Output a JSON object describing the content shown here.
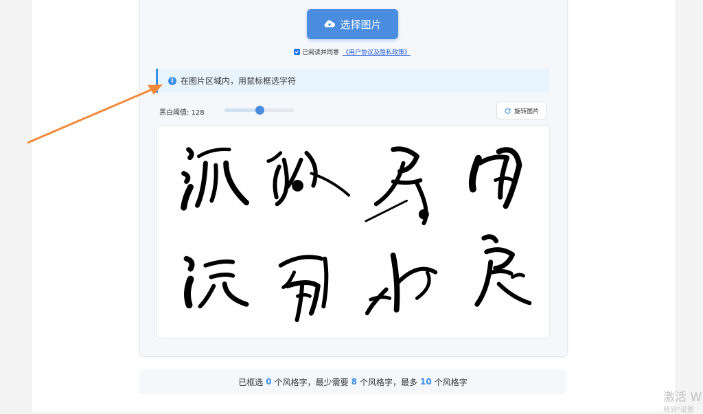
{
  "upload": {
    "label": "选择图片",
    "icon": "cloud-upload-icon"
  },
  "agreement": {
    "prefix": "已阅读并同意",
    "link": "《用户协议及隐私政策》",
    "checked": true
  },
  "tip": {
    "text": "在图片区域内，用鼠标框选字符",
    "icon": "info-icon"
  },
  "threshold": {
    "label": "黑白阈值: 128",
    "value": 128,
    "max": 255
  },
  "rotate": {
    "label": "旋转图片",
    "icon": "rotate-icon"
  },
  "status": {
    "t1": "已框选",
    "selected": "0",
    "t2": "个风格字，最少需要",
    "min": "8",
    "t3": "个风格字，最多",
    "max": "10",
    "t4": "个风格字"
  },
  "watermark": {
    "main": "激活 W",
    "sub": "转到\"设置"
  },
  "colors": {
    "accent": "#4a8de0",
    "arrow": "#f28a3c",
    "tip_bg": "#e8f4fd"
  }
}
